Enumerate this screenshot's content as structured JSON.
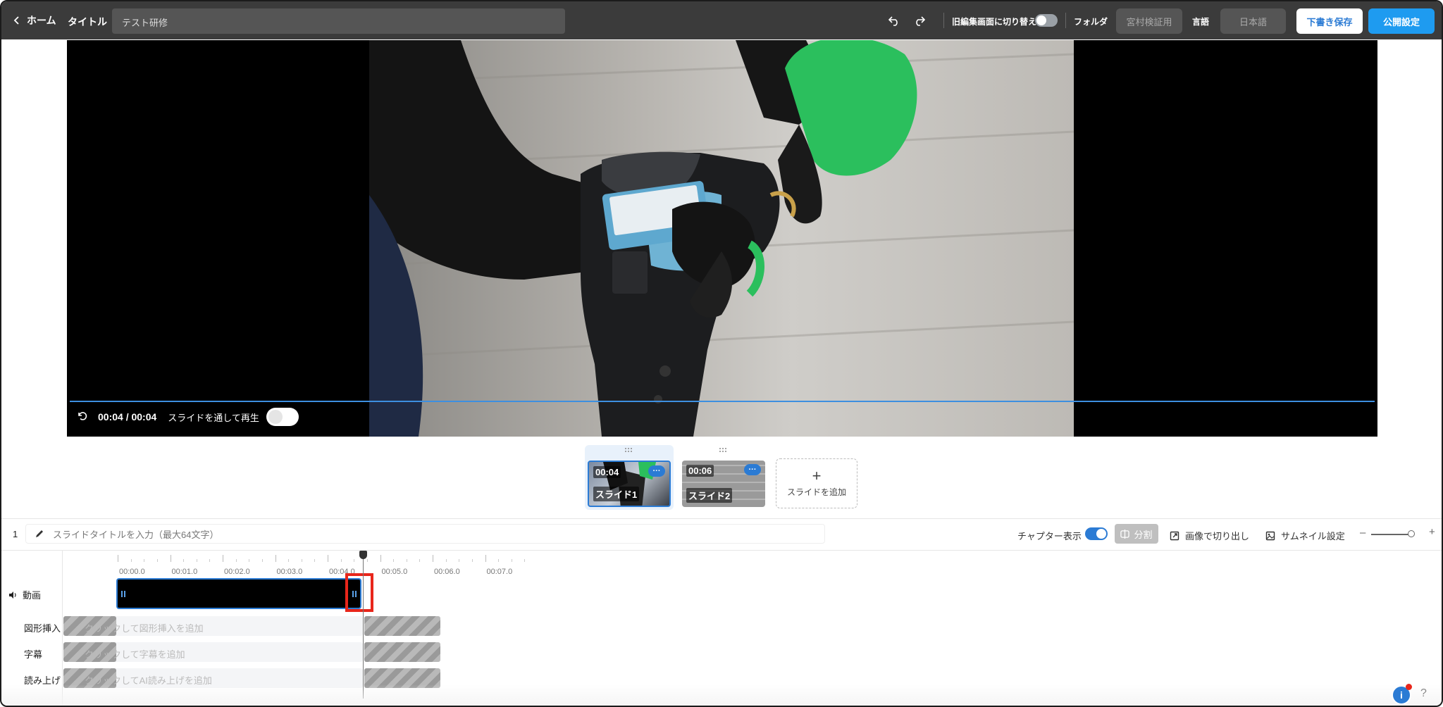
{
  "header": {
    "back_label": "ホーム",
    "title_label": "タイトル",
    "title_value": "テスト研修",
    "old_editor_label": "旧編集画面に切り替え",
    "old_editor_on": false,
    "folder_label": "フォルダ",
    "folder_value": "宮村検証用",
    "language_label": "言語",
    "language_value": "日本語",
    "save_draft": "下書き保存",
    "publish_settings": "公開設定"
  },
  "player": {
    "timecode": "00:04 / 00:04",
    "play_through_label": "スライドを通して再生",
    "play_through_on": false,
    "progress": 1.0
  },
  "slides": [
    {
      "duration": "00:04",
      "label": "スライド1",
      "active": true,
      "more": "···"
    },
    {
      "duration": "00:06",
      "label": "スライド2",
      "active": false,
      "more": "···"
    }
  ],
  "add_slide": {
    "plus": "+",
    "label": "スライドを追加"
  },
  "toolbar": {
    "slide_number": "1",
    "slide_title_placeholder": "スライドタイトルを入力（最大64文字）",
    "chapter_label": "チャプター表示",
    "chapter_on": true,
    "split_label": "分割",
    "crop_label": "画像で切り出し",
    "thumbnail_label": "サムネイル設定",
    "zoom_minus": "–",
    "zoom_plus": "+",
    "zoom_level": 0.9
  },
  "timeline": {
    "ruler": [
      "00:00.0",
      "00:01.0",
      "00:02.0",
      "00:03.0",
      "00:04.0",
      "00:05.0",
      "00:06.0",
      "00:07.0"
    ],
    "tracks": {
      "video": "動画",
      "shapes": "図形挿入",
      "subtitles": "字幕",
      "narration": "読み上げ"
    },
    "hints": {
      "shapes": "クリックして図形挿入を追加",
      "subtitles": "クリックして字幕を追加",
      "narration": "クリックしてAI読み上げを追加"
    }
  },
  "help": {
    "info": "i",
    "question": "?"
  },
  "colors": {
    "accent": "#2b7bd4",
    "header_bg": "#3b3b3b",
    "publish": "#1e9bf0",
    "highlight": "#e8261b"
  }
}
